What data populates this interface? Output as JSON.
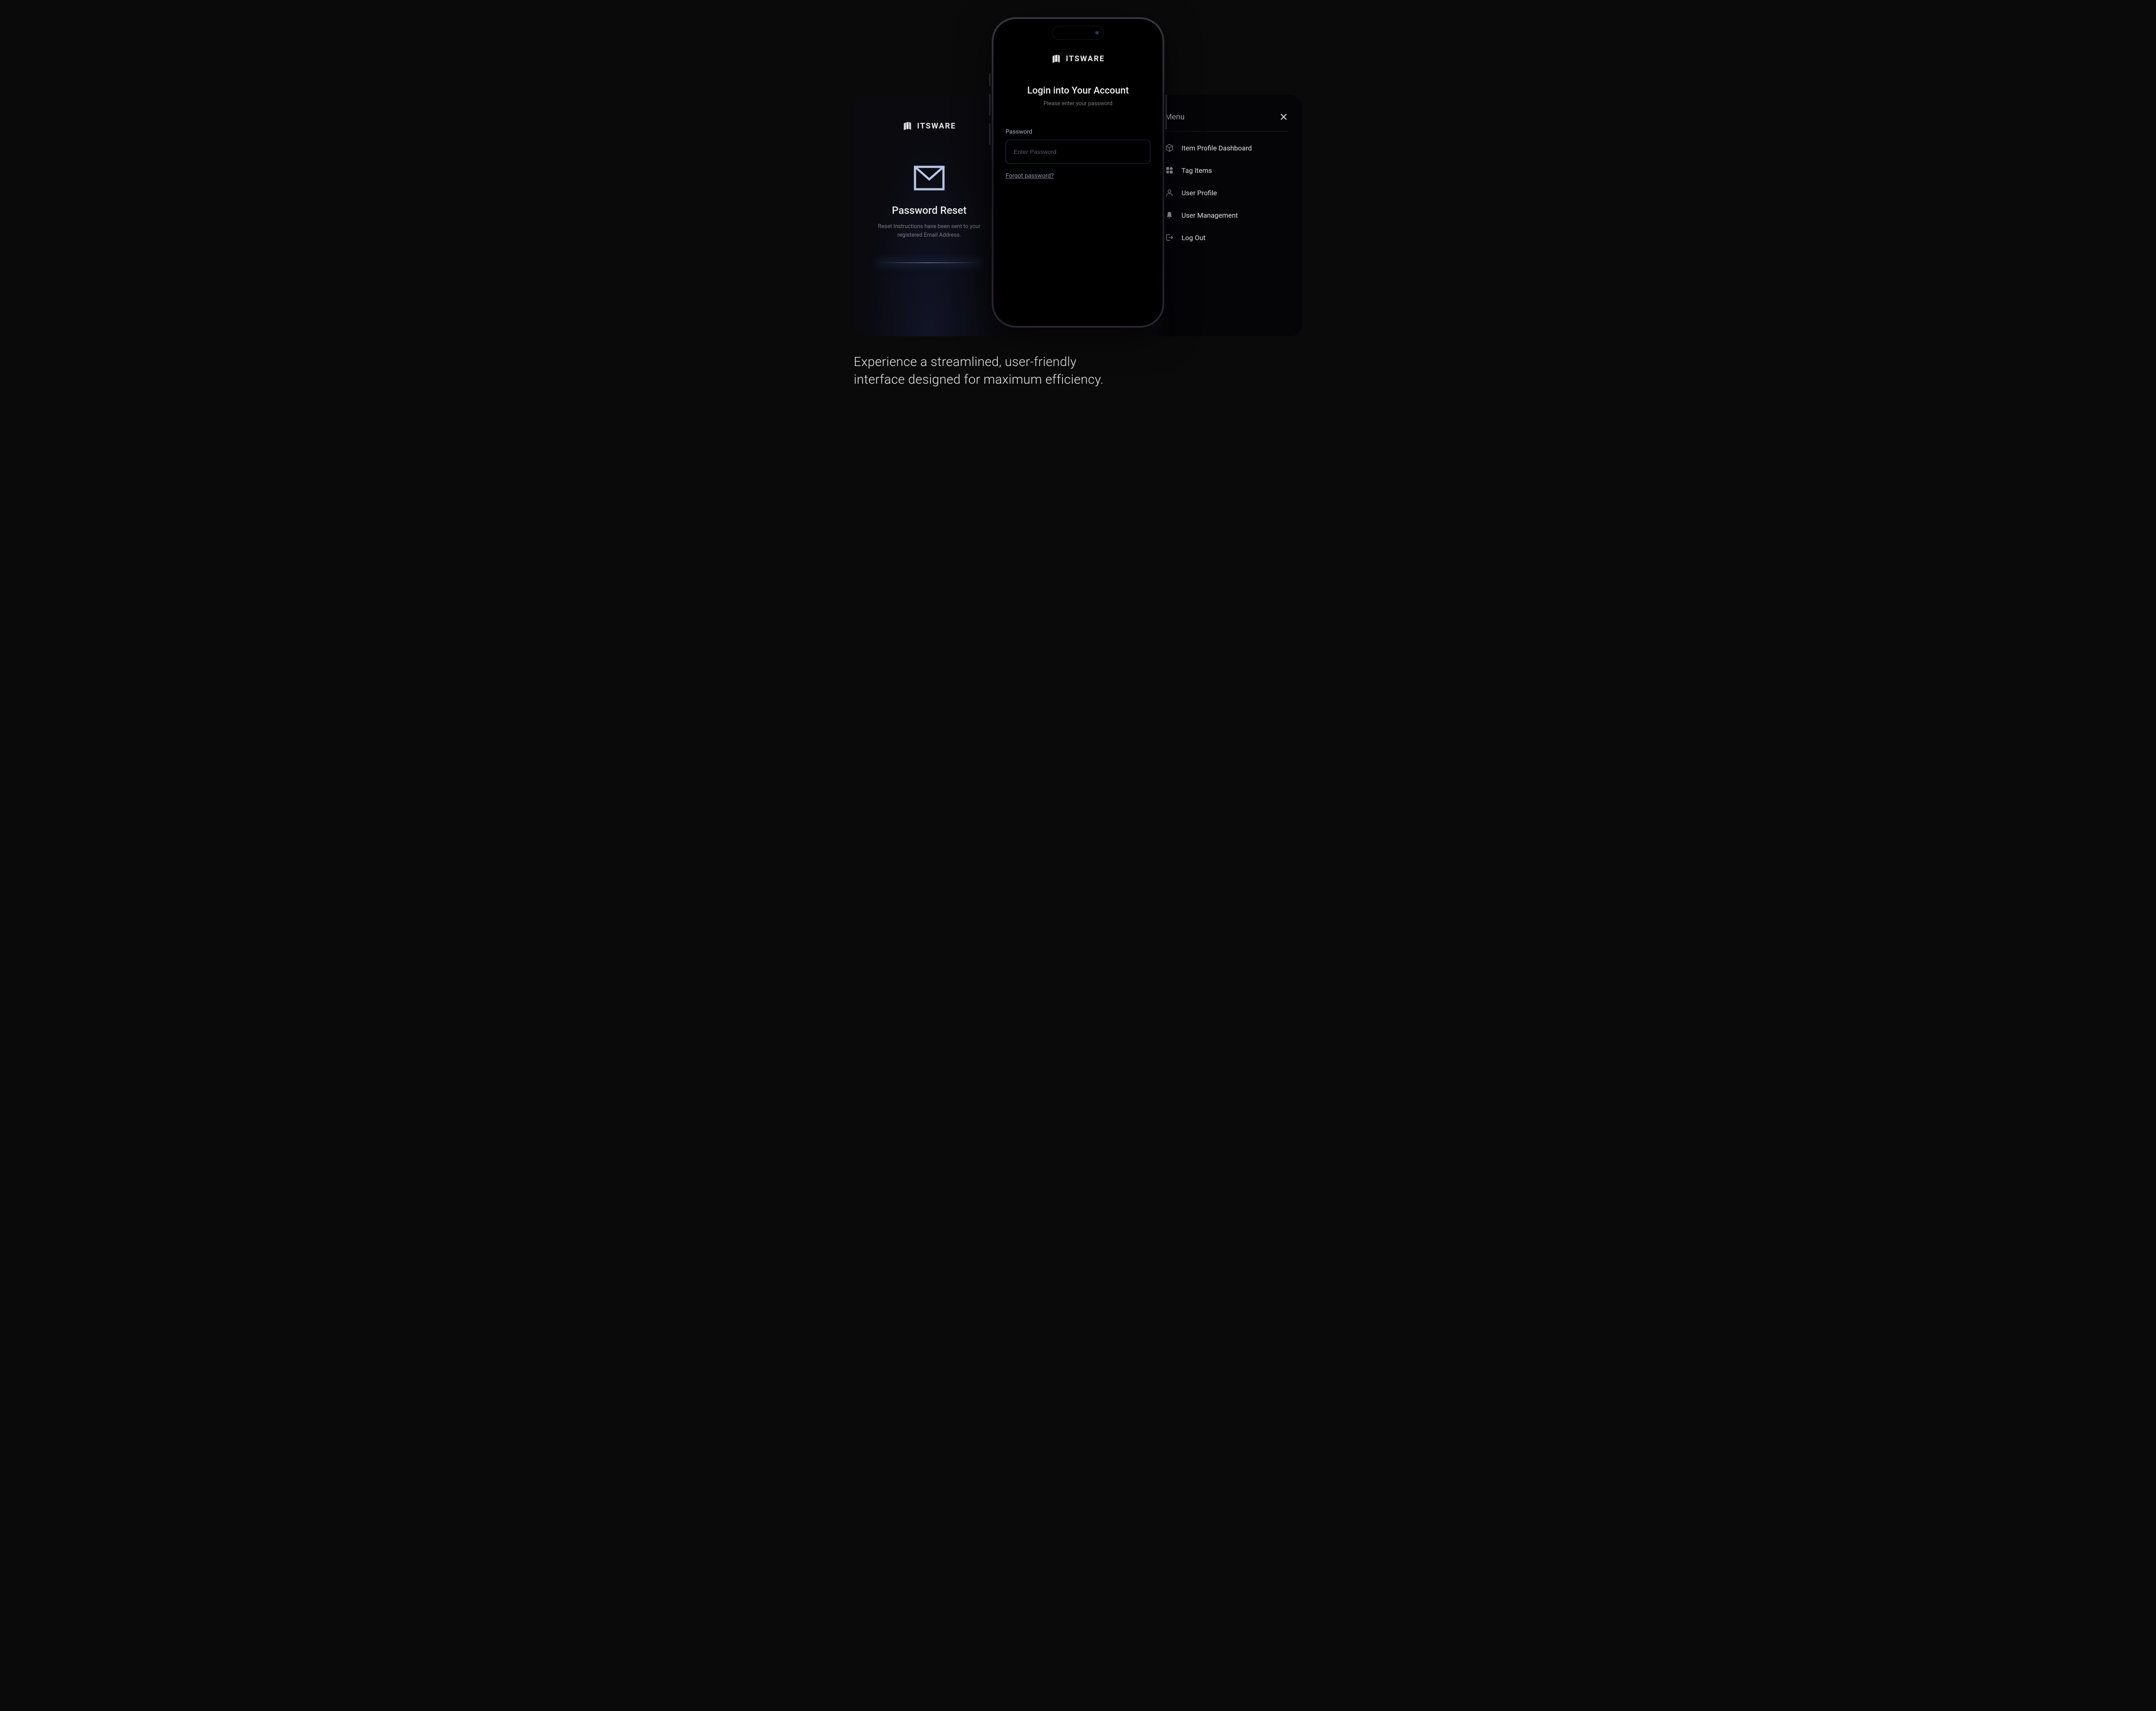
{
  "brand": "ITSWARE",
  "left": {
    "title": "Password Reset",
    "subtitle": "Reset Instructions have been sent to your registered Email Address."
  },
  "center": {
    "title": "Login into Your Account",
    "subtitle": "Please enter your password",
    "field_label": "Password",
    "placeholder": "Enter Password",
    "forgot": "Forgot password?"
  },
  "right": {
    "title": "Menu",
    "items": [
      {
        "label": "Item Profile Dashboard"
      },
      {
        "label": "Tag Items"
      },
      {
        "label": "User Profile"
      },
      {
        "label": "User Management"
      },
      {
        "label": "Log Out"
      }
    ]
  },
  "caption": "Experience a streamlined, user-friendly interface designed for maximum efficiency."
}
